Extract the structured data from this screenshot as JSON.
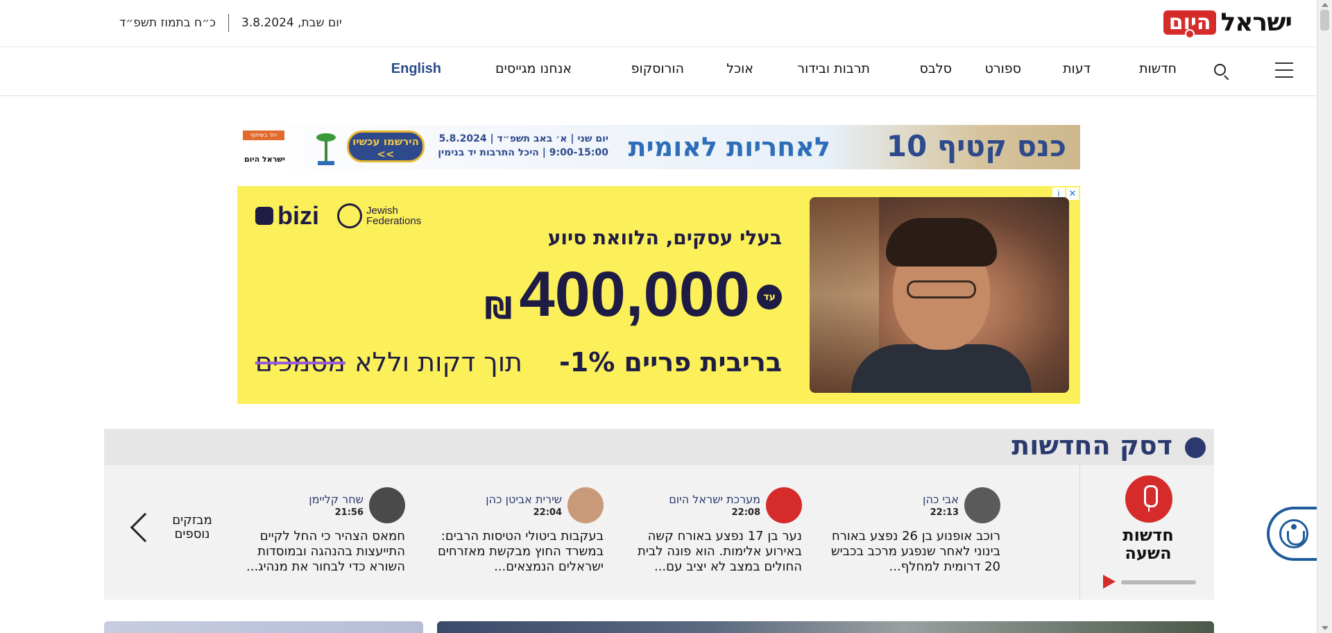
{
  "header": {
    "logo_text": "ישראל",
    "logo_box_text": "היום",
    "gregorian_date": "יום שבת, 3.8.2024",
    "hebrew_date": "כ״ח בתמוז תשפ״ד"
  },
  "nav": {
    "items": [
      "חדשות",
      "דעות",
      "ספורט",
      "סלבס",
      "תרבות ובידור",
      "אוכל",
      "הורוסקופ",
      "אנחנו מגייסים"
    ],
    "english_label": "English"
  },
  "banner_kenes": {
    "title": "כנס קטיף 10",
    "subtitle": "לאחריות לאומית",
    "date_line": "יום שני | א׳ באב תשפ״ד | 5.8.2024",
    "venue_line": "9:00-15:00 | היכל התרבות יד בנימין",
    "cta": "הירשמו עכשיו >>",
    "org_tag": "יחד בשיתוף הישראלי",
    "org_logo": "ישראל היום"
  },
  "ad": {
    "headline": "בעלי עסקים, הלוואת סיוע",
    "prefix": "עד",
    "amount": "400,000",
    "currency": "₪",
    "bottom_bold": "בריבית פריים 1%-",
    "bottom_light": "תוך דקות וללא",
    "bottom_strike": "מסמכים",
    "brand": "bizi",
    "partner_line1": "Jewish",
    "partner_line2": "Federations",
    "info_icon": "i",
    "close_icon": "✕"
  },
  "news_desk": {
    "title": "דסק החדשות",
    "live_label": "חדשות השעה",
    "more_label": "מבזקים נוספים",
    "items": [
      {
        "author": "אבי כהן",
        "time": "22:13",
        "text": "רוכב אופנוע בן 26 נפצע באורח בינוני לאחר שנפגע מרכב בכביש 20 דרומית למחלף...",
        "avatar_color": "#5a5a5a"
      },
      {
        "author": "מערכת ישראל היום",
        "time": "22:08",
        "text": "נער בן 17 נפצע באורח קשה באירוע אלימות. הוא פונה לבית החולים במצב לא יציב עם...",
        "avatar_color": "#d52b2b"
      },
      {
        "author": "שירית אביטן כהן",
        "time": "22:04",
        "text": "בעקבות ביטולי הטיסות הרבים: במשרד החוץ מבקשת מאזרחים ישראלים הנמצאים...",
        "avatar_color": "#c99a7a"
      },
      {
        "author": "שחר קליימן",
        "time": "21:56",
        "text": "חמאס הצהיר כי החל לקיים התייעצות בהנהגה ובמוסדות השורא כדי לבחור את מנהיג...",
        "avatar_color": "#4a4a4a"
      }
    ]
  },
  "colors": {
    "brand_red": "#d52b2b",
    "navy": "#2a3a6e",
    "ad_yellow": "#fbf05a",
    "english_blue": "#2a4a8a"
  }
}
